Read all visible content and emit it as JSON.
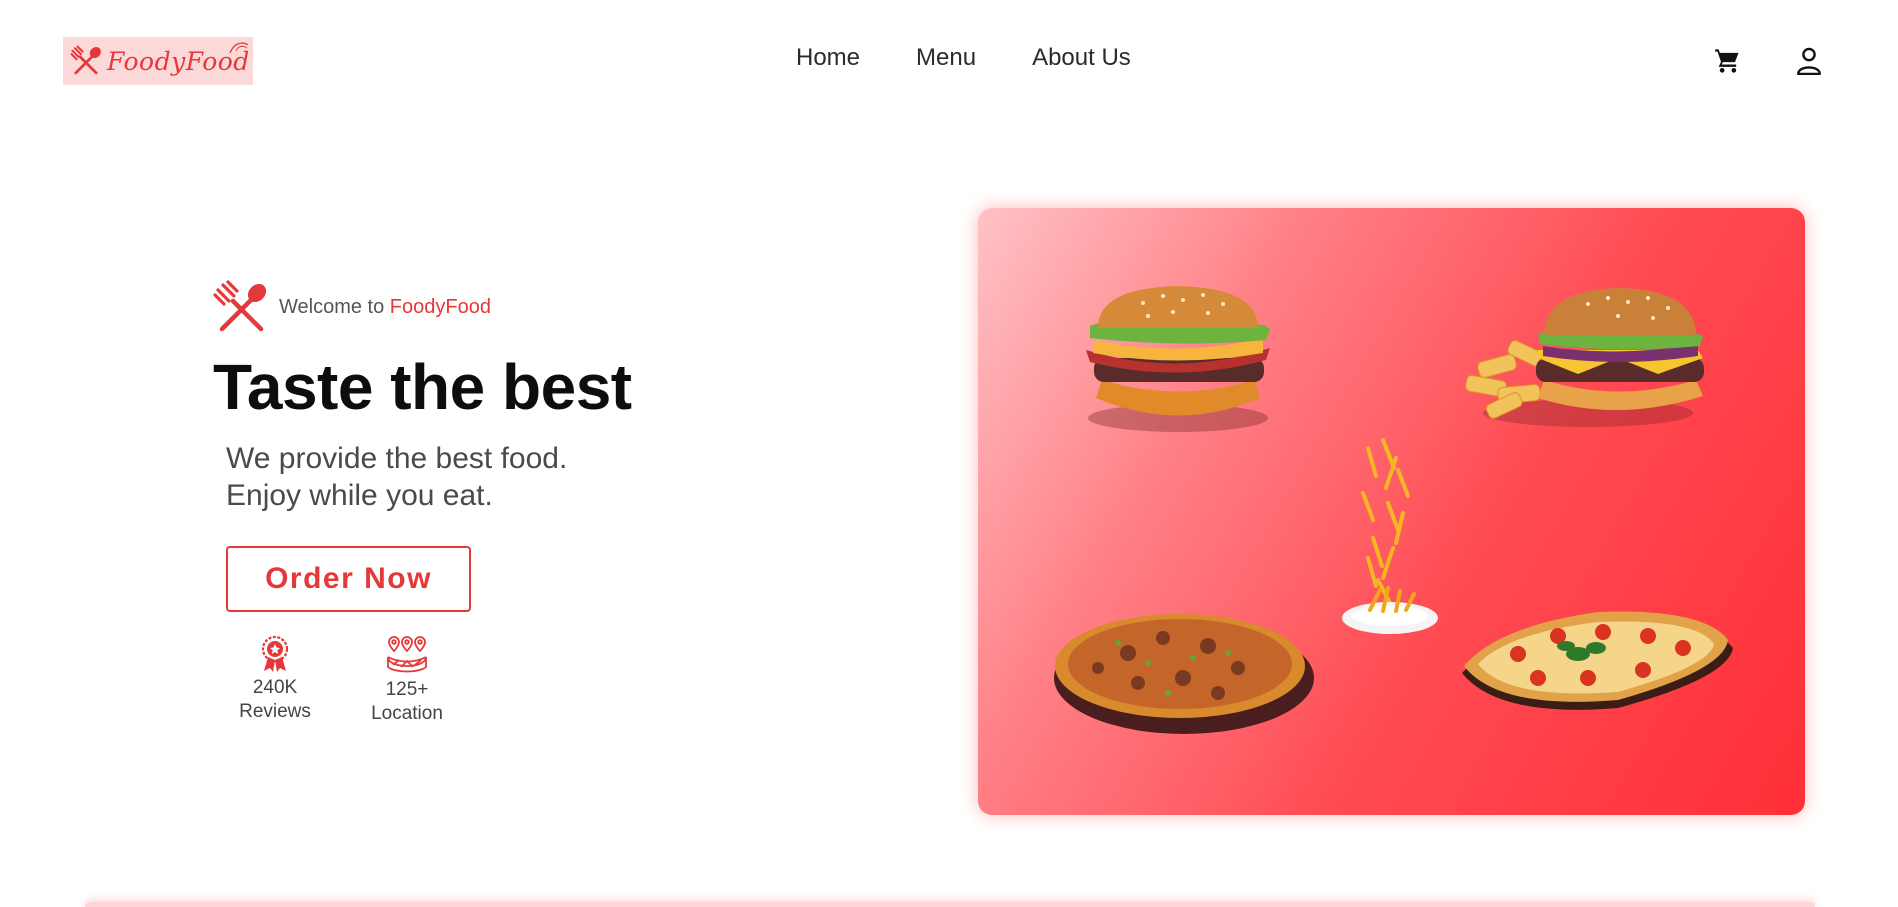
{
  "header": {
    "logo_text": "FoodyFood",
    "nav": [
      {
        "label": "Home"
      },
      {
        "label": "Menu"
      },
      {
        "label": "About Us"
      }
    ],
    "icons": [
      "cart-icon",
      "user-icon"
    ]
  },
  "hero": {
    "welcome_prefix": "Welcome to ",
    "welcome_brand": "FoodyFood",
    "title": "Taste the best",
    "subtitle_line1": "We provide the best food.",
    "subtitle_line2": "Enjoy while you eat.",
    "cta_label": "Order Now",
    "stats": [
      {
        "value": "240K",
        "label": "Reviews",
        "icon": "award-ribbon-icon"
      },
      {
        "value": "125+",
        "label": "Location",
        "icon": "location-map-icon"
      }
    ]
  },
  "colors": {
    "accent": "#e5383b",
    "logo_bg": "#fcd9d9",
    "card_gradient_start": "#ffc2c6",
    "card_gradient_end": "#ff2f37"
  },
  "image_card": {
    "items": [
      "burger",
      "burger-with-fries",
      "falling-fries-plate",
      "pizza",
      "margherita-pizza"
    ]
  }
}
